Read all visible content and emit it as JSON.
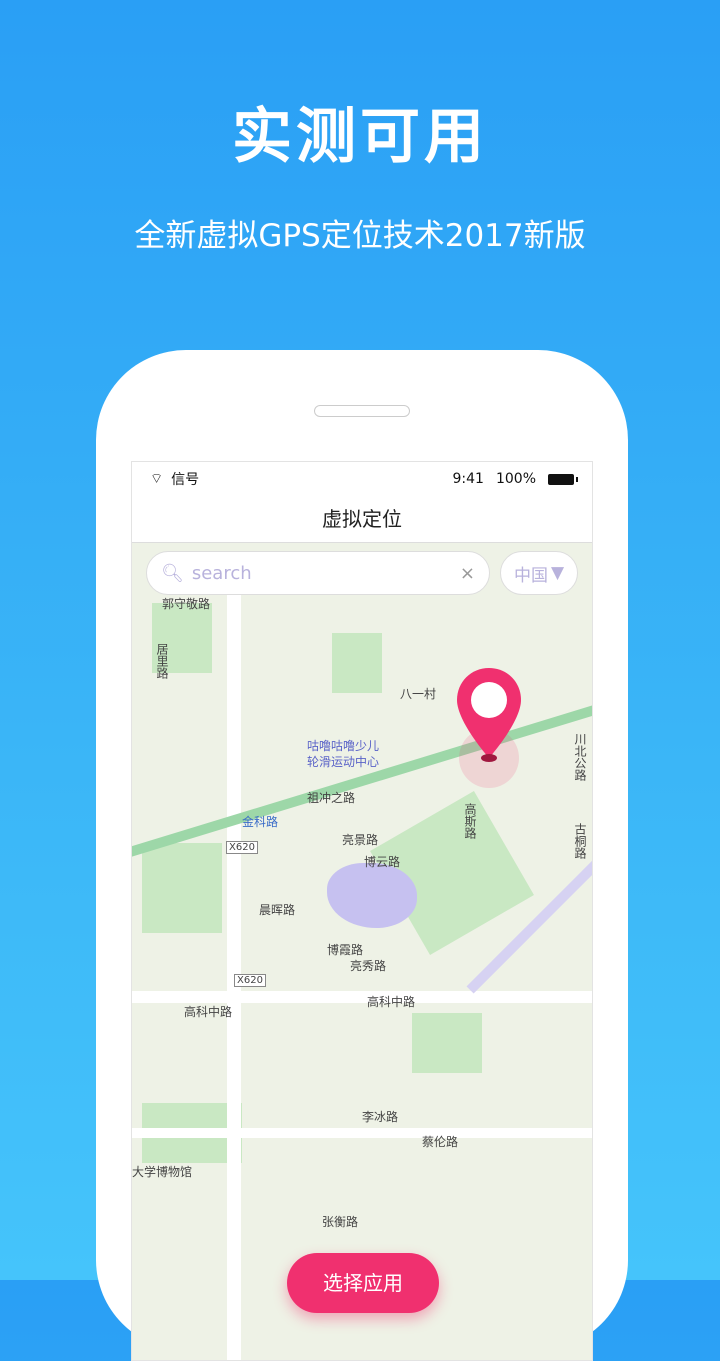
{
  "headline": "实测可用",
  "subtitle": "全新虚拟GPS定位技术2017新版",
  "status": {
    "carrier": "信号",
    "time": "9:41",
    "battery": "100%"
  },
  "nav": {
    "title": "虚拟定位"
  },
  "search": {
    "placeholder": "search",
    "clear": "×",
    "country": "中国",
    "country_arrow": "▼"
  },
  "map_labels": [
    "郭守敬路",
    "居里路",
    "八一村",
    "咕噜咕噜少儿",
    "轮滑运动中心",
    "祖冲之路",
    "金科路",
    "亮景路",
    "博云路",
    "晨晖路",
    "博霞路",
    "亮秀路",
    "高科中路",
    "高科中路",
    "李冰路",
    "蔡伦路",
    "大学博物馆",
    "高斯路",
    "川北公路",
    "古桐路",
    "X620",
    "X620",
    "张衡路"
  ],
  "action": {
    "label": "选择应用"
  },
  "colors": {
    "accent": "#f0306f",
    "background": "#2a9ff5"
  }
}
